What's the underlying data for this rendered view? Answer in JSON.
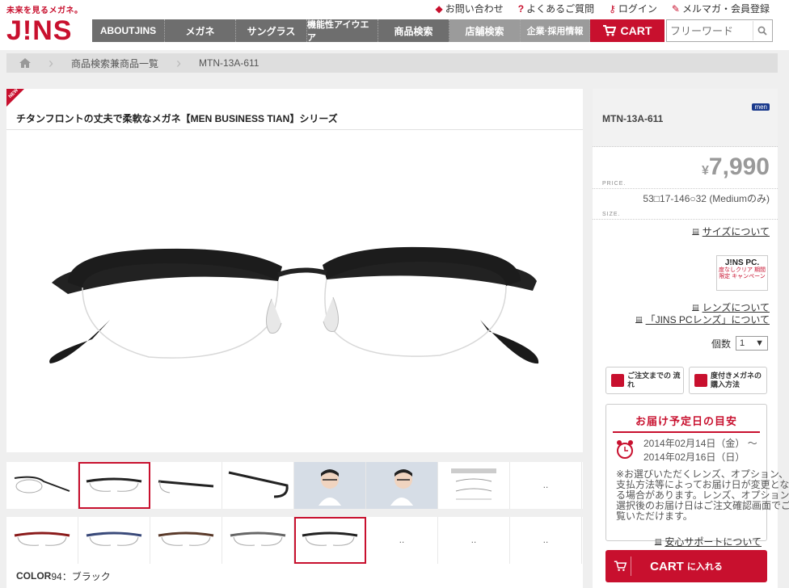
{
  "brand": {
    "tagline": "未来を見るメガネ。",
    "name": "J!NS"
  },
  "utility": [
    {
      "name": "inquiry",
      "label": "お問い合わせ",
      "icon": "tag-icon"
    },
    {
      "name": "faq",
      "label": "よくあるご質問",
      "icon": "question-icon"
    },
    {
      "name": "login",
      "label": "ログイン",
      "icon": "key-icon"
    },
    {
      "name": "register",
      "label": "メルマガ・会員登録",
      "icon": "pencil-icon"
    }
  ],
  "nav": [
    "ABOUTJINS",
    "メガネ",
    "サングラス",
    "機能性アイウエア",
    "商品検索",
    "店舗検索",
    "企業·採用情報"
  ],
  "cart_label": "CART",
  "search": {
    "placeholder": "フリーワード"
  },
  "breadcrumb": [
    "商品検索兼商品一覧",
    "MTN-13A-611"
  ],
  "product": {
    "badge": "NEW",
    "title": "チタンフロントの丈夫で柔軟なメガネ【MEN BUSINESS TIAN】シリーズ",
    "color_label": "COLOR",
    "color_value": "94：ブラック"
  },
  "thumb_placeholder": "‥",
  "side": {
    "sku": "MTN-13A-611",
    "men_badge": "men",
    "price_label": "PRICE.",
    "currency": "¥",
    "price": "7,990",
    "size_label": "SIZE.",
    "size": "53□17-146○32 (Mediumのみ)",
    "size_link": "サイズについて",
    "jinspc_title": "J!NS PC.",
    "jinspc_text": "度なしクリア 期間限定 キャンペーン",
    "lens_link": "レンズについて",
    "jinspc_link": "「JINS PCレンズ」について",
    "qty_label": "個数",
    "qty_value": "1",
    "btn_order": "ご注文までの 流れ",
    "btn_purchase": "度付きメガネの 購入方法",
    "delivery_title": "お届け予定日の目安",
    "delivery_from": "2014年02月14日（金） 〜",
    "delivery_to": "2014年02月16日（日）",
    "delivery_note": "※お選びいただくレンズ、オプション、支払方法等によってお届け日が変更となる場合があります。レンズ、オプション選択後のお届け日はご注文確認画面でご覧いただけます。",
    "support_link": "安心サポートについて",
    "cart_main": "CART",
    "cart_sub": "に入れる"
  },
  "colors": {
    "accent": "#c8102e",
    "nav": "#6e6e6e"
  }
}
